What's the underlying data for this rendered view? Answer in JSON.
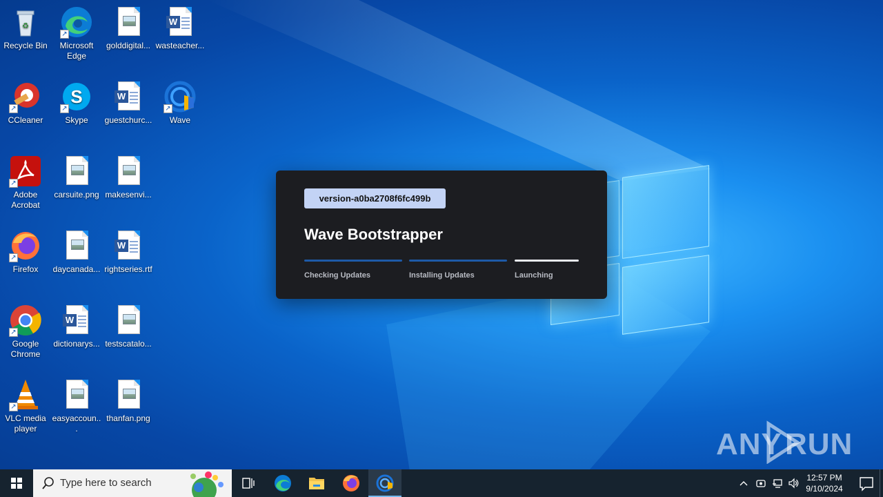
{
  "desktop_icons": [
    {
      "label": "Recycle Bin"
    },
    {
      "label": "Microsoft Edge"
    },
    {
      "label": "golddigital..."
    },
    {
      "label": "wasteacher..."
    },
    {
      "label": "CCleaner"
    },
    {
      "label": "Skype"
    },
    {
      "label": "guestchurc..."
    },
    {
      "label": "Wave"
    },
    {
      "label": "Adobe Acrobat"
    },
    {
      "label": "carsuite.png"
    },
    {
      "label": "makesenvi..."
    },
    {
      "label": "Firefox"
    },
    {
      "label": "daycanada..."
    },
    {
      "label": "rightseries.rtf"
    },
    {
      "label": "Google Chrome"
    },
    {
      "label": "dictionarys..."
    },
    {
      "label": "testscatalo..."
    },
    {
      "label": "VLC media player"
    },
    {
      "label": "easyaccoun..."
    },
    {
      "label": "thanfan.png"
    }
  ],
  "dialog": {
    "version": "version-a0ba2708f6fc499b",
    "title": "Wave Bootstrapper",
    "steps": [
      {
        "label": "Checking Updates",
        "state": "done"
      },
      {
        "label": "Installing Updates",
        "state": "done"
      },
      {
        "label": "Launching",
        "state": "active"
      }
    ],
    "colors": {
      "background": "#1c1d21",
      "pill": "#c3d3f5",
      "done_bar": "#1e5aa8",
      "active_bar": "#e8eaf0"
    }
  },
  "taskbar": {
    "search_placeholder": "Type here to search",
    "time": "12:57 PM",
    "date": "9/10/2024",
    "pinned": [
      "task-view-icon",
      "edge-icon",
      "file-explorer-icon",
      "firefox-icon",
      "wave-icon"
    ]
  },
  "watermark": {
    "text": "ANY RUN"
  }
}
